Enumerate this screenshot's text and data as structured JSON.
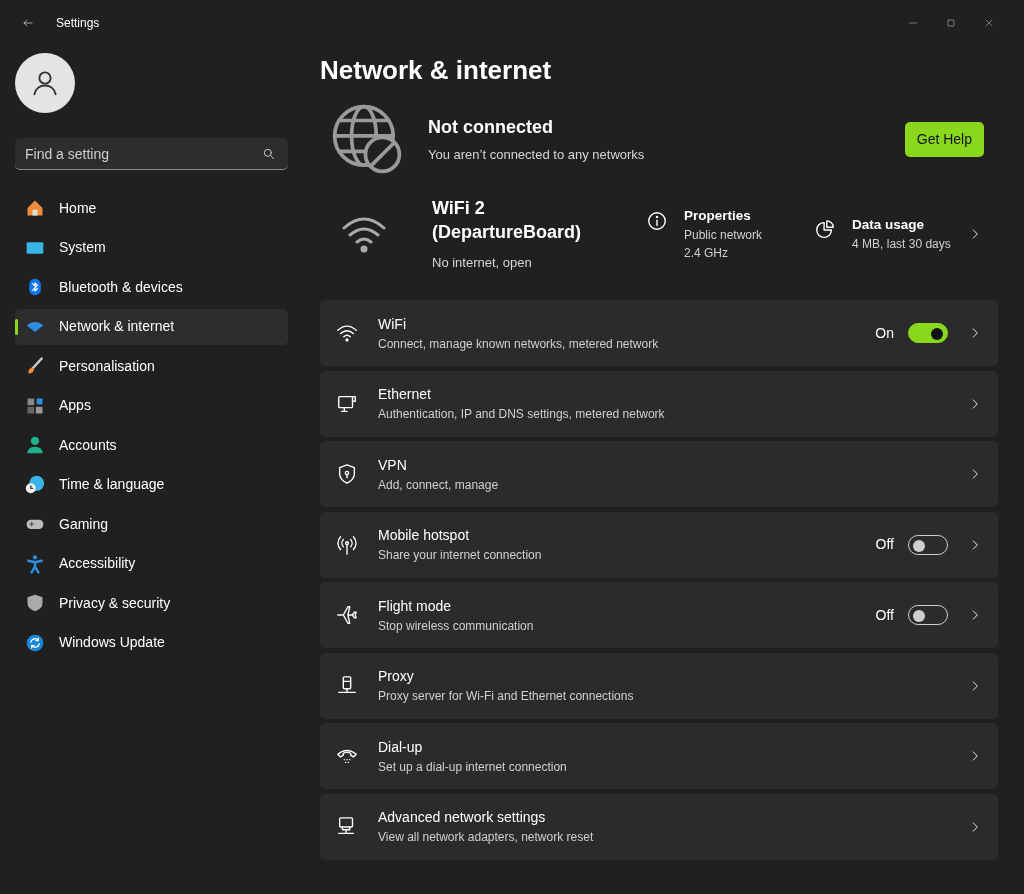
{
  "window": {
    "title": "Settings"
  },
  "search": {
    "placeholder": "Find a setting"
  },
  "sidebar": {
    "items": [
      {
        "label": "Home",
        "selected": false
      },
      {
        "label": "System",
        "selected": false
      },
      {
        "label": "Bluetooth & devices",
        "selected": false
      },
      {
        "label": "Network & internet",
        "selected": true
      },
      {
        "label": "Personalisation",
        "selected": false
      },
      {
        "label": "Apps",
        "selected": false
      },
      {
        "label": "Accounts",
        "selected": false
      },
      {
        "label": "Time & language",
        "selected": false
      },
      {
        "label": "Gaming",
        "selected": false
      },
      {
        "label": "Accessibility",
        "selected": false
      },
      {
        "label": "Privacy & security",
        "selected": false
      },
      {
        "label": "Windows Update",
        "selected": false
      }
    ]
  },
  "page_title": "Network & internet",
  "status": {
    "title": "Not connected",
    "subtitle": "You aren’t connected to any networks",
    "button": "Get Help"
  },
  "network": {
    "name": "WiFi 2 (DepartureBoard)",
    "state": "No internet, open",
    "properties": {
      "title": "Properties",
      "lines": [
        "Public network",
        "2.4 GHz"
      ]
    },
    "data_usage": {
      "title": "Data usage",
      "lines": [
        "4 MB, last 30 days"
      ]
    }
  },
  "settings": [
    {
      "kind": "toggle",
      "title": "WiFi",
      "subtitle": "Connect, manage known networks, metered network",
      "toggle_label": "On",
      "on": true
    },
    {
      "kind": "link",
      "title": "Ethernet",
      "subtitle": "Authentication, IP and DNS settings, metered network"
    },
    {
      "kind": "link",
      "title": "VPN",
      "subtitle": "Add, connect, manage"
    },
    {
      "kind": "toggle",
      "title": "Mobile hotspot",
      "subtitle": "Share your internet connection",
      "toggle_label": "Off",
      "on": false
    },
    {
      "kind": "toggle",
      "title": "Flight mode",
      "subtitle": "Stop wireless communication",
      "toggle_label": "Off",
      "on": false
    },
    {
      "kind": "link",
      "title": "Proxy",
      "subtitle": "Proxy server for Wi-Fi and Ethernet connections"
    },
    {
      "kind": "link",
      "title": "Dial-up",
      "subtitle": "Set up a dial-up internet connection"
    },
    {
      "kind": "link",
      "title": "Advanced network settings",
      "subtitle": "View all network adapters, network reset"
    }
  ]
}
